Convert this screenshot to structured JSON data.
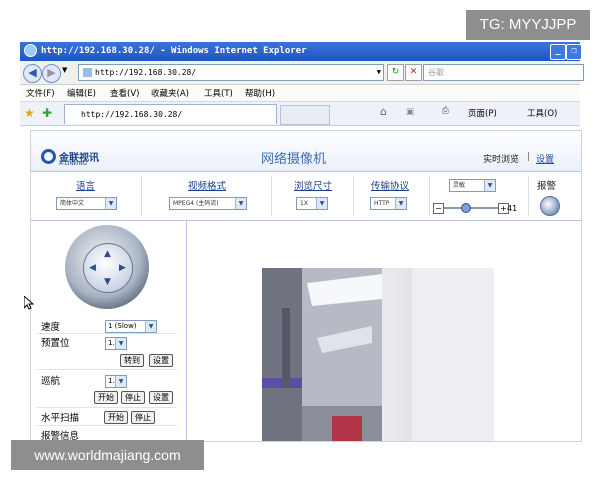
{
  "watermark_top": "TG: MYYJJPP",
  "watermark_bottom": "www.worldmajiang.com",
  "window": {
    "title": "http://192.168.30.28/ - Windows Internet Explorer",
    "minimize": "_",
    "restore": "❐"
  },
  "address_bar": {
    "url": "http://192.168.30.28/",
    "search_placeholder": "谷歌"
  },
  "menu": [
    "文件(F)",
    "编辑(E)",
    "查看(V)",
    "收藏夹(A)",
    "工具(T)",
    "帮助(H)"
  ],
  "tab": {
    "title": "http://192.168.30.28/"
  },
  "command_bar": {
    "page": "页面(P)",
    "tools": "工具(O)"
  },
  "header": {
    "logo_text": "金联视讯",
    "logo_sub": "A-LINKING",
    "title": "网络摄像机",
    "live_view": "实时浏览",
    "separator": "|",
    "settings": "设置"
  },
  "controls": {
    "language_label": "语言",
    "language_value": "简体中文",
    "video_format_label": "视频格式",
    "video_format_value": "MPEG4 (主码流)",
    "view_size_label": "浏览尺寸",
    "view_size_value": "1X",
    "protocol_label": "传输协议",
    "protocol_value": "HTTP",
    "preset_value": "灵敏",
    "slider_value": "41",
    "slider_minus": "−",
    "slider_plus": "+",
    "alarm_label": "报警"
  },
  "ptz_panel": {
    "speed_label": "速度",
    "speed_value": "1 (Slow)",
    "preset_label": "预置位",
    "preset_value": "1.",
    "goto_button": "转到",
    "set_button": "设置",
    "cruise_label": "巡航",
    "cruise_value": "1.",
    "start_button": "开始",
    "stop_button": "停止",
    "cruise_set_button": "设置",
    "hscan_label": "水平扫描",
    "hscan_start": "开始",
    "hscan_stop": "停止",
    "alarm_info_label": "报警信息"
  },
  "colors": {
    "title_bar": "#1f55c2",
    "link_blue": "#1a4fb0",
    "header_title": "#3a6fb8"
  }
}
